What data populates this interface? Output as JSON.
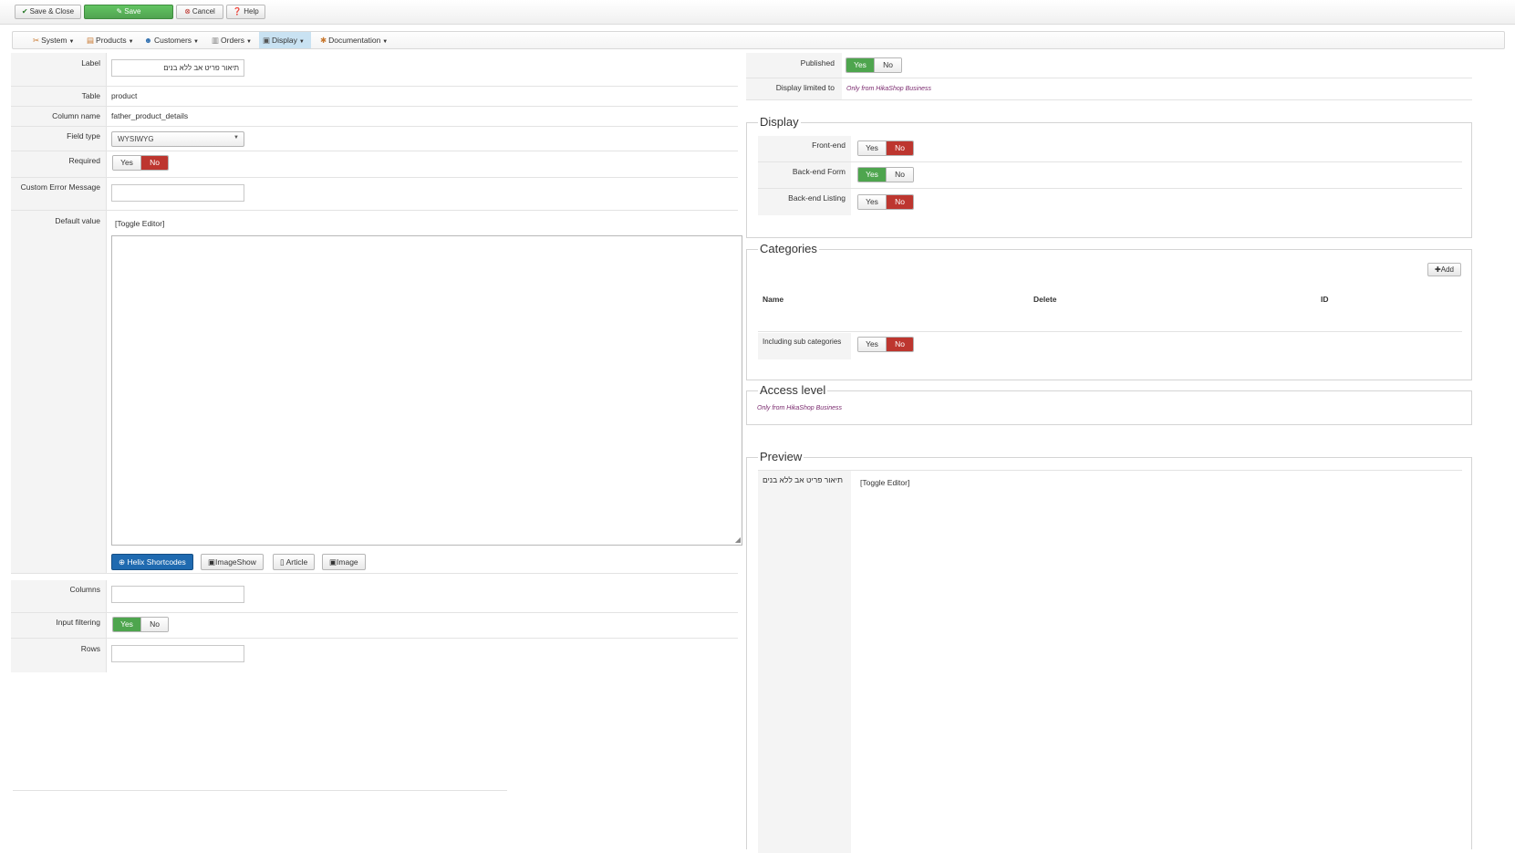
{
  "toolbar": {
    "save_close": "Save & Close",
    "save": "Save",
    "cancel": "Cancel",
    "help": "Help"
  },
  "menu": {
    "system": "System",
    "products": "Products",
    "customers": "Customers",
    "orders": "Orders",
    "display": "Display",
    "documentation": "Documentation"
  },
  "form": {
    "label_lbl": "Label",
    "label_value": "תיאור פריט אב ללא בנים",
    "table_lbl": "Table",
    "table_value": "product",
    "column_lbl": "Column name",
    "column_value": "father_product_details",
    "fieldtype_lbl": "Field type",
    "fieldtype_value": "WYSIWYG",
    "required_lbl": "Required",
    "custom_error_lbl": "Custom Error Message",
    "custom_error_value": "",
    "default_lbl": "Default value",
    "toggle_editor": "[Toggle Editor]",
    "btn_helix": "Helix Shortcodes",
    "btn_imageshow": "ImageShow",
    "btn_article": "Article",
    "btn_image": "Image",
    "columns_lbl": "Columns",
    "columns_value": "",
    "input_filtering_lbl": "Input filtering",
    "rows_lbl": "Rows",
    "rows_value": "",
    "yes": "Yes",
    "no": "No"
  },
  "right": {
    "published_lbl": "Published",
    "display_limited_lbl": "Display limited to",
    "only_business": "Only from HikaShop Business",
    "display_legend": "Display",
    "frontend_lbl": "Front-end",
    "backend_form_lbl": "Back-end Form",
    "backend_listing_lbl": "Back-end Listing",
    "categories_legend": "Categories",
    "add_btn": "Add",
    "col_name": "Name",
    "col_delete": "Delete",
    "col_id": "ID",
    "including_sub_lbl": "Including sub categories",
    "access_legend": "Access level",
    "preview_legend": "Preview",
    "preview_label": "תיאור פריט אב ללא בנים",
    "preview_toggle": "[Toggle Editor]"
  },
  "colors": {
    "green": "#4ea54e",
    "red": "#bd362f",
    "blue": "#1f6ab0"
  }
}
